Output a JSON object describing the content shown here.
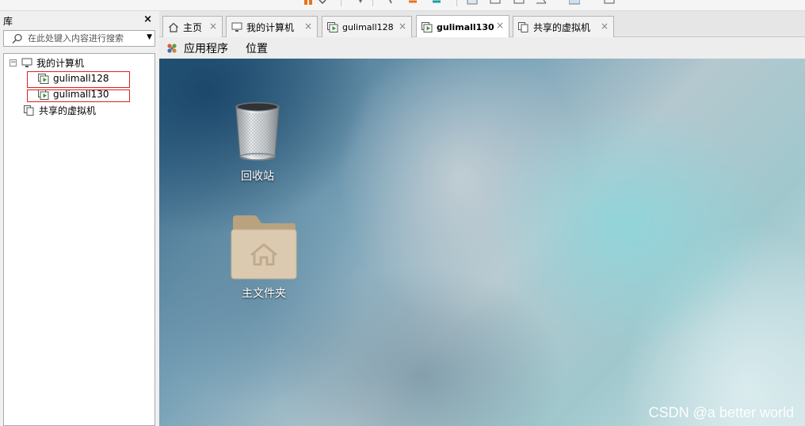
{
  "library": {
    "title": "库",
    "close_glyph": "×",
    "search": {
      "placeholder": "在此处键入内容进行搜索"
    },
    "tree": {
      "toggle_glyph": "−",
      "root": "我的计算机",
      "vms": [
        {
          "label": "gulimall128"
        },
        {
          "label": "gulimall130"
        }
      ],
      "shared": "共享的虚拟机"
    }
  },
  "tabs": [
    {
      "label": "主页",
      "icon": "home-icon"
    },
    {
      "label": "我的计算机",
      "icon": "computer-icon"
    },
    {
      "label": "gulimall128",
      "icon": "vm-icon"
    },
    {
      "label": "gulimall130",
      "icon": "vm-icon",
      "active": true
    },
    {
      "label": "共享的虚拟机",
      "icon": "shared-vms-icon"
    }
  ],
  "tab_close_glyph": "×",
  "guest_menu": {
    "applications": "应用程序",
    "places": "位置"
  },
  "desktop": {
    "icons": [
      {
        "label": "回收站",
        "icon": "trash-icon"
      },
      {
        "label": "主文件夹",
        "icon": "home-folder-icon"
      }
    ]
  },
  "watermark": "CSDN @a better world",
  "colors": {
    "highlight_box": "#e02020",
    "vm_running_green": "#2ea02e",
    "desktop_dark": "#1f4a6e",
    "desktop_light": "#9fd3d6"
  }
}
